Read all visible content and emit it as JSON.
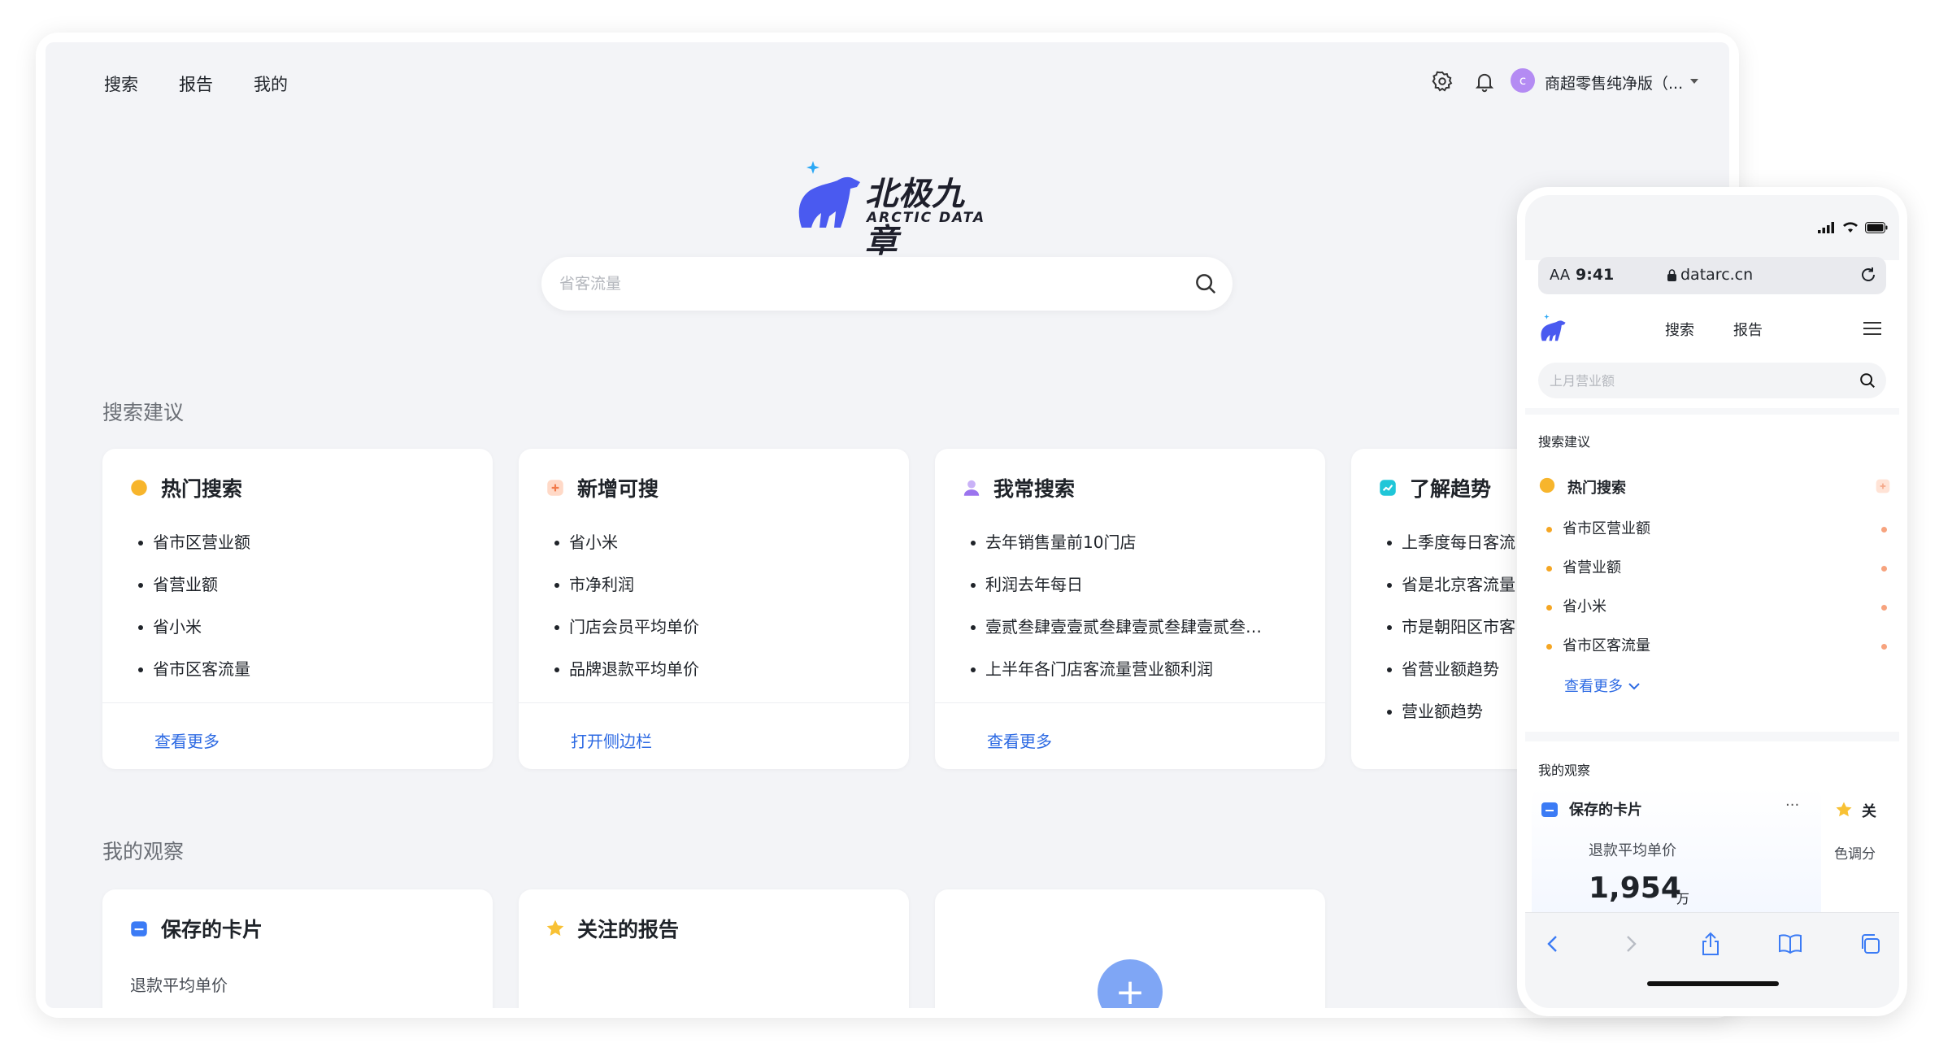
{
  "desktop": {
    "nav": [
      "搜索",
      "报告",
      "我的"
    ],
    "org_name": "商超零售纯净版（...",
    "avatar_letter": "c",
    "brand": {
      "cn": "北极九章",
      "en": "ARCTIC DATA"
    },
    "search": {
      "placeholder": "省客流量"
    },
    "suggestions": {
      "title": "搜索建议",
      "cards": [
        {
          "title": "热门搜索",
          "items": [
            "省市区营业额",
            "省营业额",
            "省小米",
            "省市区客流量"
          ],
          "link": "查看更多"
        },
        {
          "title": "新增可搜",
          "items": [
            "省小米",
            "市净利润",
            "门店会员平均单价",
            "品牌退款平均单价"
          ],
          "link": "打开侧边栏"
        },
        {
          "title": "我常搜索",
          "items": [
            "去年销售量前10门店",
            "利润去年每日",
            "壹贰叁肆壹壹贰叁肆壹贰叁肆壹贰叁…",
            "上半年各门店客流量营业额利润"
          ],
          "link": "查看更多"
        },
        {
          "title": "了解趋势",
          "items": [
            "上季度每日客流",
            "省是北京客流量",
            "市是朝阳区市客",
            "省营业额趋势",
            "营业额趋势"
          ]
        }
      ]
    },
    "observe": {
      "title": "我的观察",
      "cards": [
        {
          "title": "保存的卡片",
          "subtitle": "退款平均单价"
        },
        {
          "title": "关注的报告"
        }
      ],
      "add_symbol": "+"
    }
  },
  "mobile": {
    "time": "9:41",
    "text_size": "AA",
    "url": "datarc.cn",
    "nav": [
      "搜索",
      "报告"
    ],
    "search": {
      "placeholder": "上月营业额"
    },
    "suggestions": {
      "title": "搜索建议",
      "card_title": "热门搜索",
      "items": [
        "省市区营业额",
        "省营业额",
        "省小米",
        "省市区客流量"
      ],
      "more": "查看更多"
    },
    "observe": {
      "title": "我的观察",
      "card_title": "保存的卡片",
      "card_menu": "···",
      "metric_label": "退款平均单价",
      "metric_value": "1,954",
      "metric_unit": "万",
      "next_card_title": "关",
      "next_card_sub": "色调分"
    }
  },
  "colors": {
    "accent": "#2d6ae3",
    "brand": "#4a5af0",
    "page_bg": "#f3f4f7"
  }
}
